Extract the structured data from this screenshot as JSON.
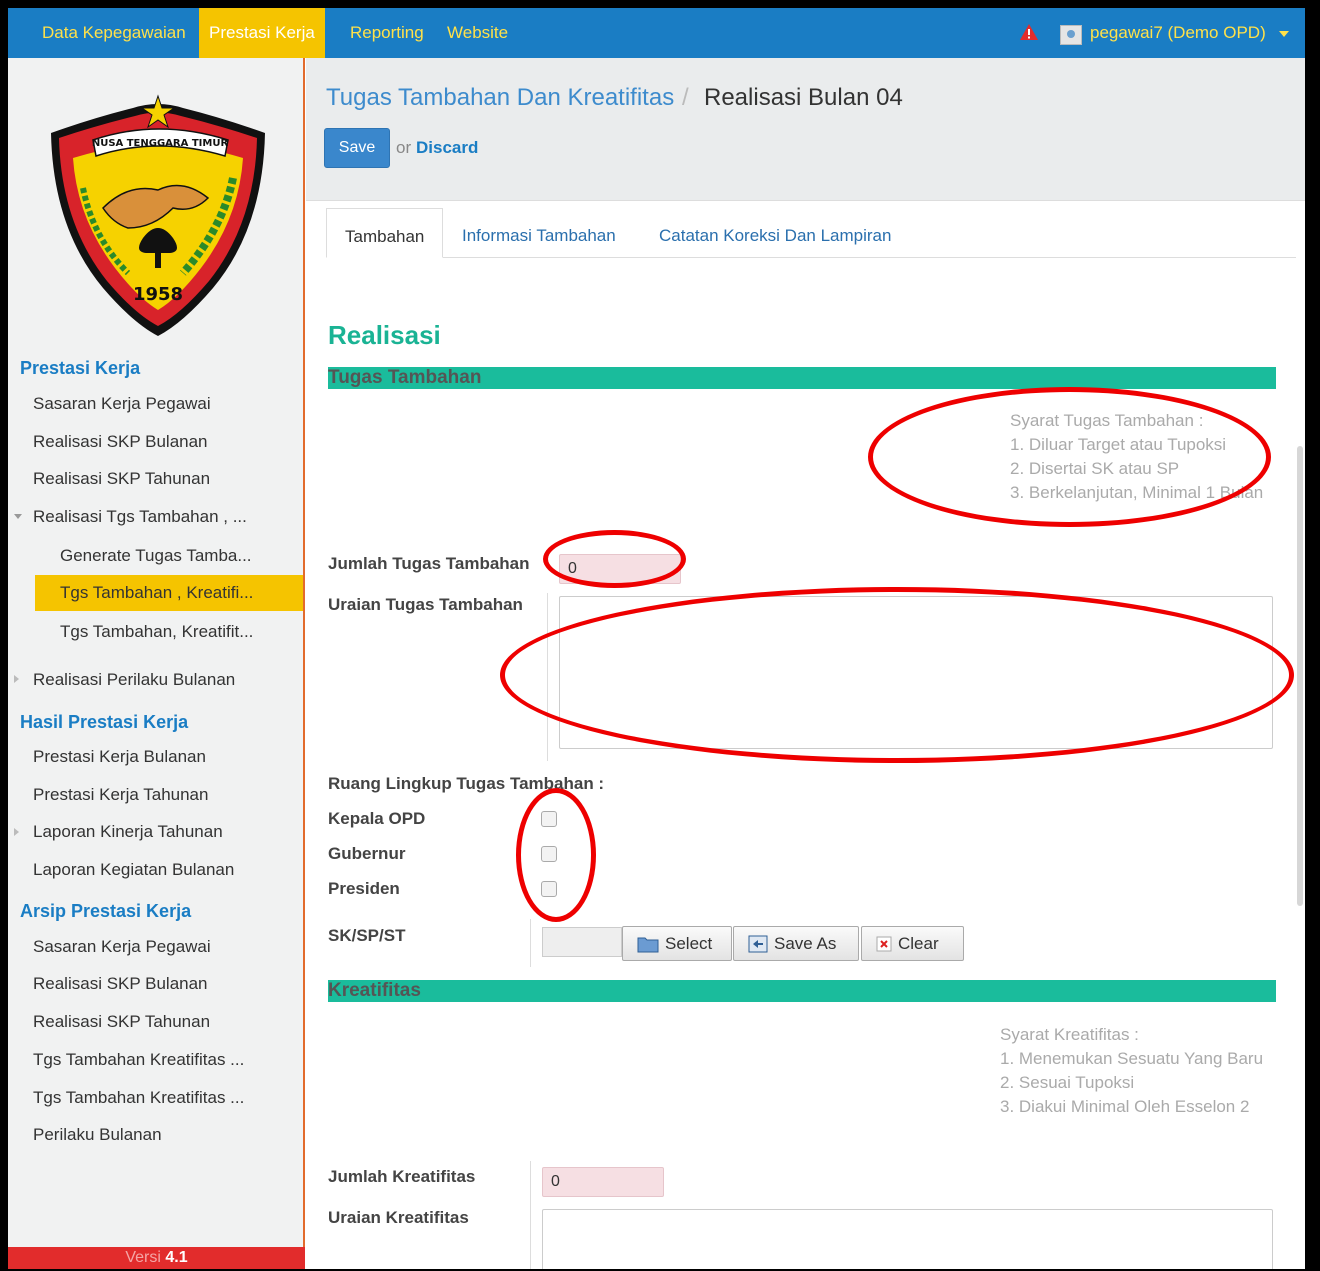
{
  "nav": {
    "items": [
      "Data Kepegawaian",
      "Prestasi Kerja",
      "Reporting",
      "Website"
    ],
    "active": "Prestasi Kerja",
    "user": "pegawai7 (Demo OPD)"
  },
  "logo": {
    "ribbon_text": "NUSA TENGGARA TIMUR",
    "year": "1958"
  },
  "sidebar": {
    "section1": "Prestasi Kerja",
    "items1": [
      "Sasaran Kerja Pegawai",
      "Realisasi SKP Bulanan",
      "Realisasi SKP Tahunan",
      "Realisasi Tgs Tambahan , ..."
    ],
    "sub_items": [
      "Generate Tugas Tamba...",
      "Tgs Tambahan , Kreatifi...",
      "Tgs Tambahan, Kreatifit..."
    ],
    "item_perilaku": "Realisasi Perilaku Bulanan",
    "section2": "Hasil Prestasi Kerja",
    "items2": [
      "Prestasi Kerja Bulanan",
      "Prestasi Kerja Tahunan",
      "Laporan Kinerja Tahunan",
      "Laporan Kegiatan Bulanan"
    ],
    "section3": "Arsip Prestasi Kerja",
    "items3": [
      "Sasaran Kerja Pegawai",
      "Realisasi SKP Bulanan",
      "Realisasi SKP Tahunan",
      "Tgs Tambahan Kreatifitas ...",
      "Tgs Tambahan Kreatifitas ...",
      "Perilaku Bulanan"
    ],
    "version_label": "Versi",
    "version_num": "4.1"
  },
  "header": {
    "breadcrumb_link": "Tugas Tambahan Dan Kreatifitas",
    "breadcrumb_sep": "/",
    "breadcrumb_current": "Realisasi Bulan 04",
    "save_label": "Save",
    "or_text": "or",
    "discard_label": "Discard"
  },
  "tabs": [
    "Tambahan",
    "Informasi Tambahan",
    "Catatan Koreksi Dan Lampiran"
  ],
  "form": {
    "title": "Realisasi",
    "tugas_bar": "Tugas Tambahan",
    "tugas_notes": [
      "Syarat Tugas Tambahan :",
      "1. Diluar Target atau Tupoksi",
      "2. Disertai SK atau SP",
      "3. Berkelanjutan, Minimal 1 Bulan"
    ],
    "jumlah_tugas_label": "Jumlah Tugas Tambahan",
    "jumlah_tugas_value": "0",
    "uraian_tugas_label": "Uraian Tugas Tambahan",
    "ruang_label": "Ruang Lingkup Tugas Tambahan :",
    "checkbox_labels": [
      "Kepala OPD",
      "Gubernur",
      "Presiden"
    ],
    "sk_label": "SK/SP/ST",
    "btn_select": "Select",
    "btn_saveas": "Save As",
    "btn_clear": "Clear",
    "kreatif_bar": "Kreatifitas",
    "kreatif_notes": [
      "Syarat Kreatifitas :",
      "1. Menemukan Sesuatu Yang Baru",
      "2. Sesuai Tupoksi",
      "3. Diakui Minimal Oleh Esselon 2"
    ],
    "jumlah_kreatif_label": "Jumlah Kreatifitas",
    "jumlah_kreatif_value": "0",
    "uraian_kreatif_label": "Uraian Kreatifitas"
  },
  "colors": {
    "nav_bg": "#1a7dc4",
    "nav_active": "#f5c400",
    "accent_green": "#1abc9c",
    "annotation_red": "#ee0000"
  }
}
